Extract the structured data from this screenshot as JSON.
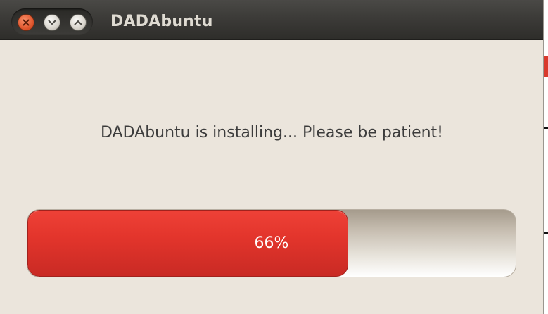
{
  "window": {
    "title": "DADAbuntu",
    "controls": [
      {
        "name": "close",
        "icon": "close-icon"
      },
      {
        "name": "minimize",
        "icon": "chevron-down-icon"
      },
      {
        "name": "maximize",
        "icon": "chevron-up-icon"
      }
    ]
  },
  "installer": {
    "message": "DADAbuntu is installing... Please be patient!",
    "progress": {
      "percent": 66,
      "label": "66%"
    }
  },
  "colors": {
    "progress_fill": "#e3352c",
    "window_bg": "#ebe5dc",
    "titlebar_bg": "#3c3b38"
  }
}
